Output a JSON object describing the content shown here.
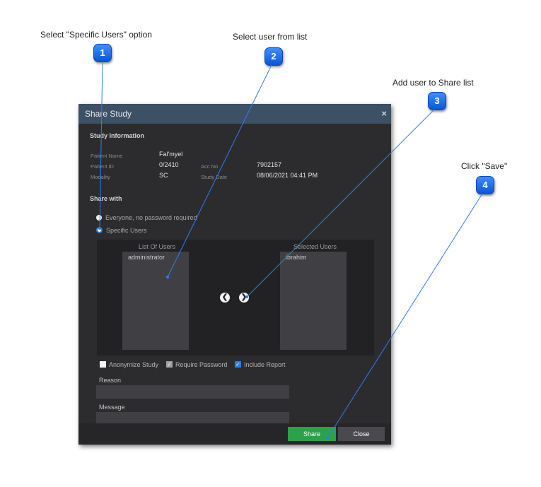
{
  "callouts": [
    {
      "number": "1",
      "label": "Select \"Specific Users\" option"
    },
    {
      "number": "2",
      "label": "Select user from list"
    },
    {
      "number": "3",
      "label": "Add user to Share list"
    },
    {
      "number": "4",
      "label": "Click \"Save\""
    }
  ],
  "dialog": {
    "title": "Share Study",
    "close_glyph": "×",
    "study_info": {
      "heading": "Study Information",
      "patient_name_label": "Patient Name",
      "patient_name": "Fal'myel",
      "patient_id_label": "Patient ID",
      "patient_id": "0/2410",
      "acc_no_label": "Acc No",
      "acc_no": "7902157",
      "modality_label": "Modality",
      "modality": "SC",
      "study_date_label": "Study Date",
      "study_date": "08/06/2021 04:41 PM"
    },
    "share_with": {
      "heading": "Share with",
      "option_everyone": "Everyone, no password required",
      "option_specific": "Specific Users",
      "selected_option": "Specific Users"
    },
    "transfer": {
      "list_of_users_title": "List Of Users",
      "list_of_users": [
        "administrator"
      ],
      "selected_users_title": "Selected Users",
      "selected_users": [
        "ibrahim"
      ],
      "left_arrow_icon": "arrow-left-circle",
      "right_arrow_icon": "arrow-right-circle"
    },
    "options": {
      "anonymize_label": "Anonymize Study",
      "anonymize_checked": false,
      "require_password_label": "Require Password",
      "require_password_checked": true,
      "include_report_label": "Include Report",
      "include_report_checked": true
    },
    "reason": {
      "label": "Reason",
      "value": ""
    },
    "message": {
      "label": "Message",
      "value": ""
    },
    "buttons": {
      "share": "Share",
      "close": "Close"
    }
  },
  "colors": {
    "badge": "#1a6cf0",
    "title_bar": "#3d5166",
    "share_button": "#2aa14b",
    "callout_line": "#2f7bf5"
  }
}
